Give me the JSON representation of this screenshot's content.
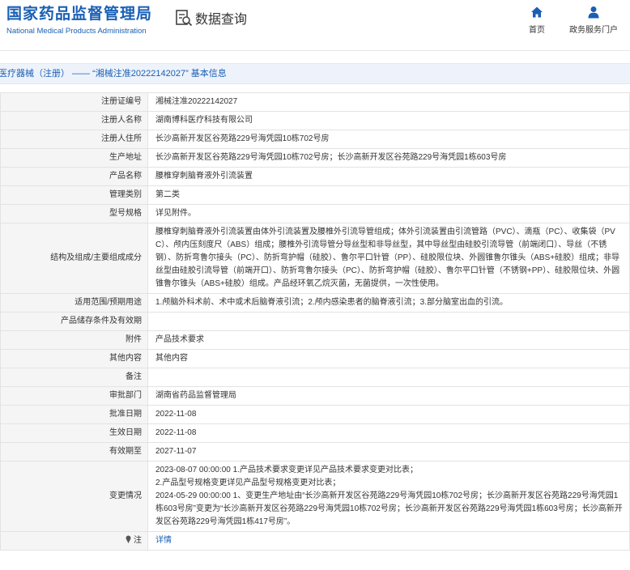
{
  "header": {
    "logo_cn": "国家药品监督管理局",
    "logo_en": "National Medical Products Administration",
    "query_label": "数据查询",
    "nav": [
      {
        "label": "首页",
        "icon": "home-icon"
      },
      {
        "label": "政务服务门户",
        "icon": "user-icon"
      }
    ]
  },
  "breadcrumb": "医疗器械（注册） —— “湘械注准20222142027” 基本信息",
  "colors": {
    "brand": "#1a5fb4",
    "label_bg": "#f5f5f5",
    "border": "#e3e3e3"
  },
  "rows": [
    {
      "label": "注册证编号",
      "value": "湘械注准20222142027"
    },
    {
      "label": "注册人名称",
      "value": "湖南博科医疗科技有限公司"
    },
    {
      "label": "注册人住所",
      "value": "长沙高新开发区谷苑路229号海凭园10栋702号房"
    },
    {
      "label": "生产地址",
      "value": "长沙高新开发区谷苑路229号海凭园10栋702号房；长沙高新开发区谷苑路229号海凭园1栋603号房"
    },
    {
      "label": "产品名称",
      "value": "腰椎穿刺脑脊液外引流装置"
    },
    {
      "label": "管理类别",
      "value": "第二类"
    },
    {
      "label": "型号规格",
      "value": "详见附件。"
    },
    {
      "label": "结构及组成/主要组成成分",
      "value": "腰椎穿刺脑脊液外引流装置由体外引流装置及腰椎外引流导管组成；体外引流装置由引流管路（PVC）、滴瓶（PC）、收集袋（PVC）、颅内压刻度尺（ABS）组成；腰椎外引流导管分导丝型和非导丝型，其中导丝型由硅胶引流导管（前端闭口）、导丝（不锈钢）、防折弯鲁尔接头（PC）、防折弯护帽（硅胶）、鲁尔平口针管（PP）、硅胶限位块、外圆锥鲁尔锥头（ABS+硅胶）组成；非导丝型由硅胶引流导管（前端开口）、防折弯鲁尔接头（PC）、防折弯护帽（硅胶）、鲁尔平口针管（不锈钢+PP）、硅胶限位块、外圆锥鲁尔锥头（ABS+硅胶）组成。产品经环氧乙烷灭菌，无菌提供，一次性使用。"
    },
    {
      "label": "适用范围/预期用途",
      "value": "1.颅脑外科术前、术中或术后脑脊液引流；2.颅内感染患者的脑脊液引流；3.部分脑室出血的引流。"
    },
    {
      "label": "产品储存条件及有效期",
      "value": ""
    },
    {
      "label": "附件",
      "value": "产品技术要求"
    },
    {
      "label": "其他内容",
      "value": "其他内容"
    },
    {
      "label": "备注",
      "value": ""
    },
    {
      "label": "审批部门",
      "value": "湖南省药品监督管理局"
    },
    {
      "label": "批准日期",
      "value": "2022-11-08"
    },
    {
      "label": "生效日期",
      "value": "2022-11-08"
    },
    {
      "label": "有效期至",
      "value": "2027-11-07"
    },
    {
      "label": "变更情况",
      "value": "",
      "lines": [
        "2023-08-07 00:00:00 1.产品技术要求变更详见产品技术要求变更对比表；",
        "2.产品型号规格变更详见产品型号规格变更对比表；",
        "2024-05-29 00:00:00 1、变更生产地址由“长沙高新开发区谷苑路229号海凭园10栋702号房；长沙高新开发区谷苑路229号海凭园1栋603号房”变更为“长沙高新开发区谷苑路229号海凭园10栋702号房；长沙高新开发区谷苑路229号海凭园1栋603号房；长沙高新开发区谷苑路229号海凭园1栋417号房”。"
      ]
    },
    {
      "label": "注",
      "value": "详情",
      "icon": "pin-icon",
      "link": true
    }
  ]
}
